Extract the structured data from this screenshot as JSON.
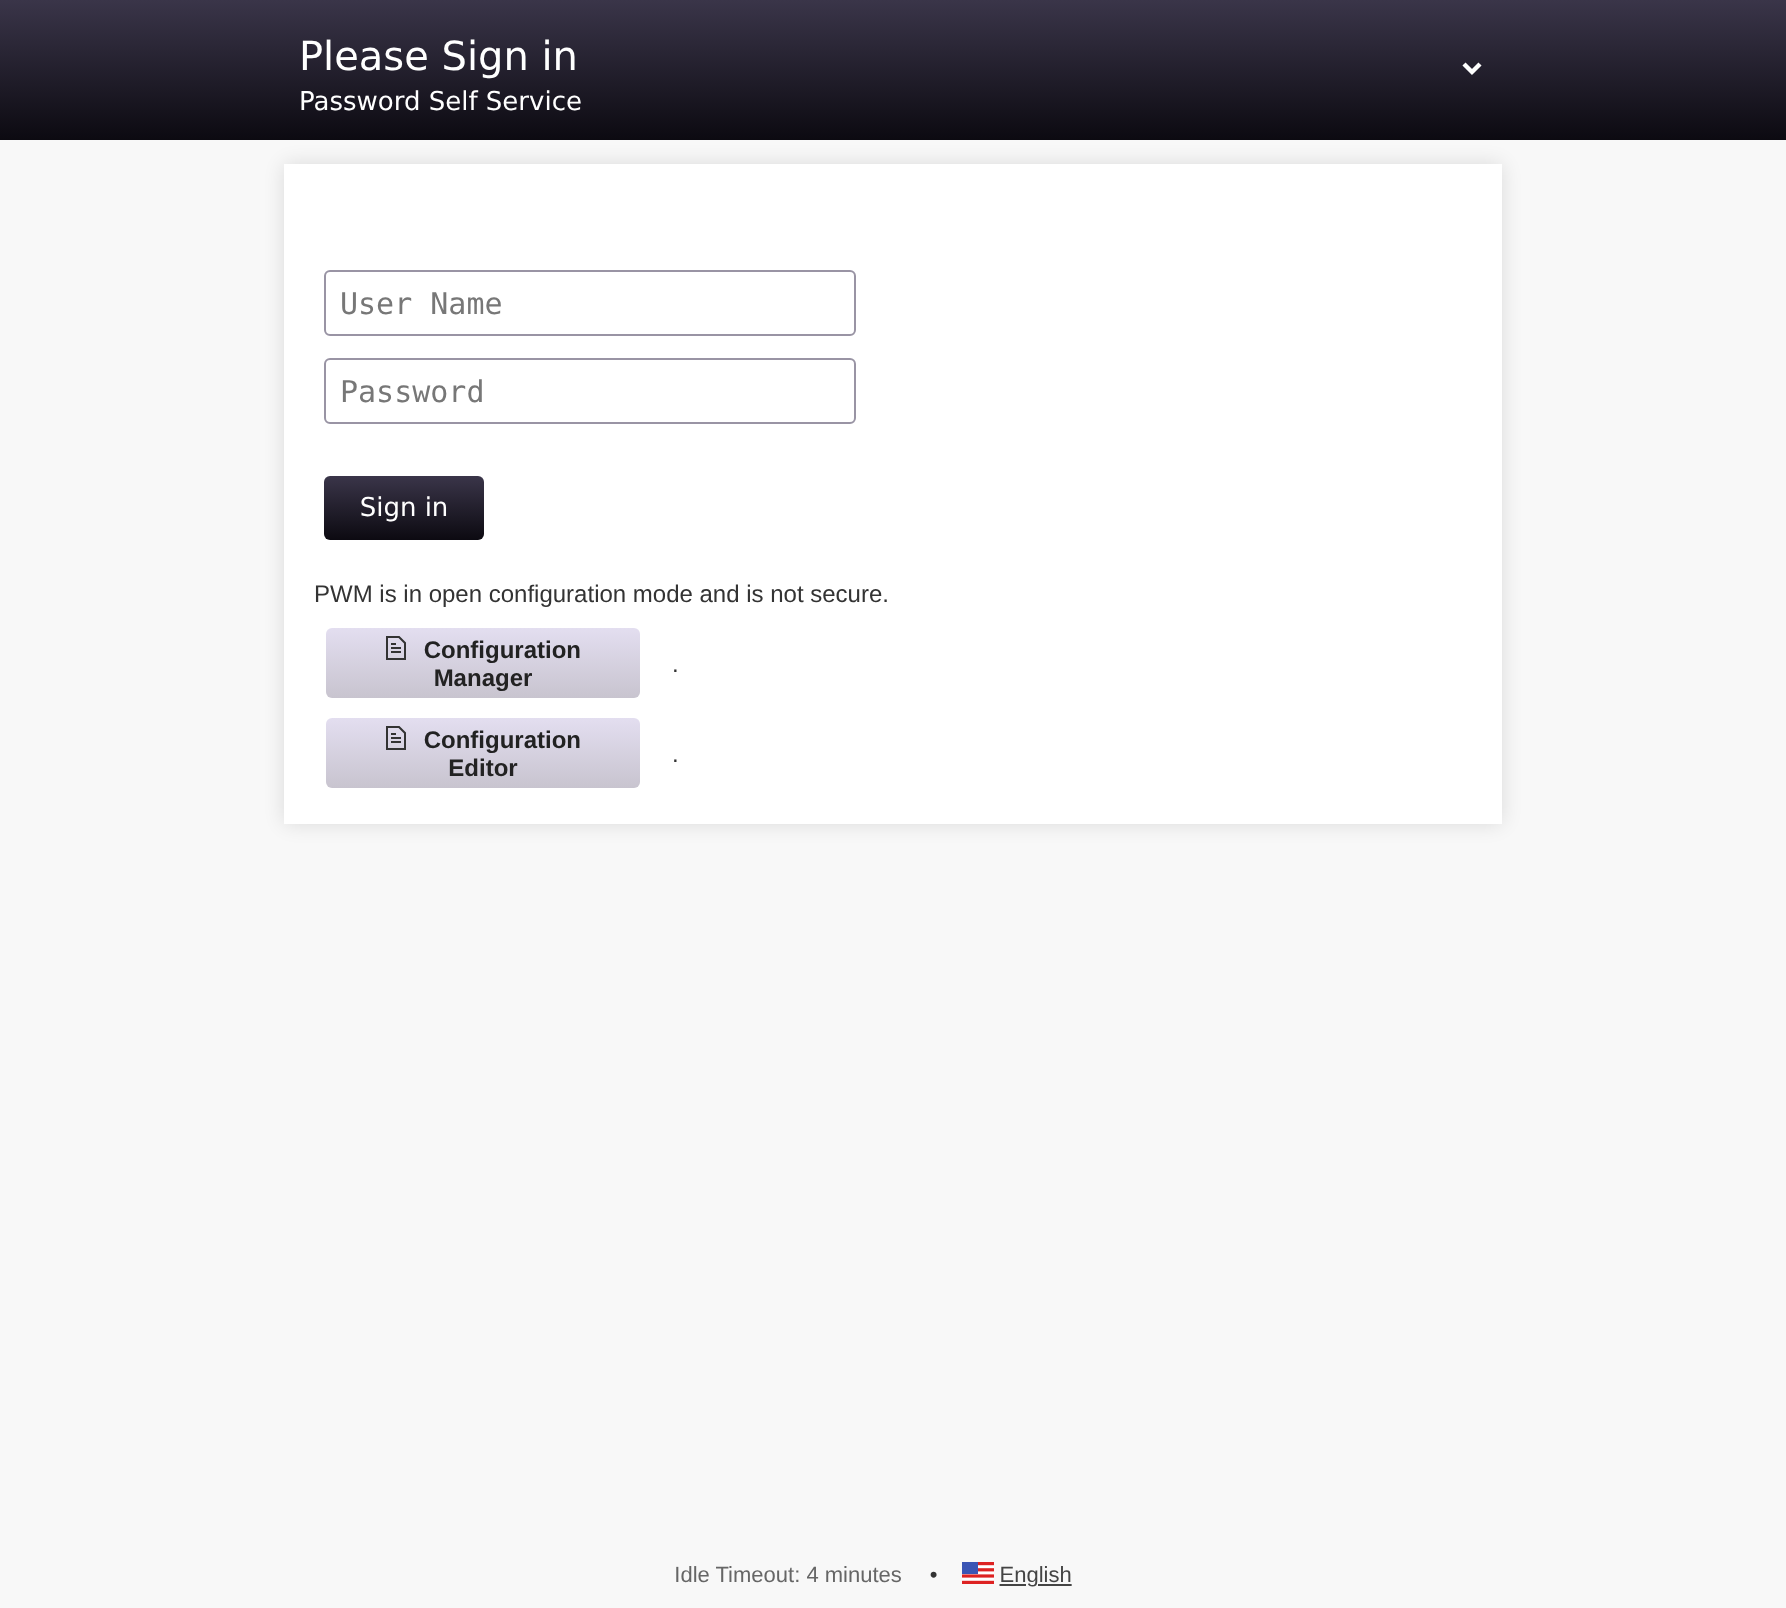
{
  "header": {
    "title": "Please Sign in",
    "subtitle": "Password Self Service"
  },
  "login": {
    "username": {
      "placeholder": "User Name"
    },
    "password": {
      "placeholder": "Password"
    },
    "submit": "Sign in"
  },
  "notice": "PWM is in open configuration mode and is not secure.",
  "config_actions": [
    {
      "label": "Configuration Manager",
      "description": "."
    },
    {
      "label": "Configuration Editor",
      "description": "."
    }
  ],
  "footer": {
    "idle_timeout": "Idle Timeout: 4 minutes",
    "separator": "•",
    "language": "English"
  }
}
